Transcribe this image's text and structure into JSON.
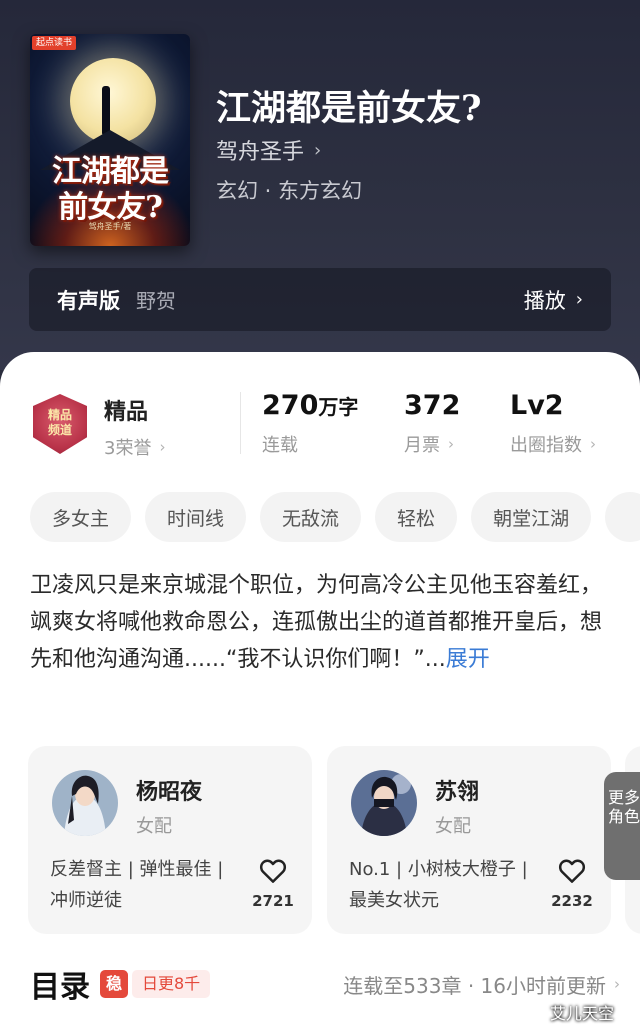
{
  "book": {
    "title": "江湖都是前女友?",
    "author": "驾舟圣手",
    "genre": "玄幻 · 东方玄幻",
    "cover": {
      "badge": "起点读书",
      "title_line1": "江湖都是",
      "title_line2": "前女友?",
      "author_small": "驾舟圣手/著"
    }
  },
  "audio": {
    "label": "有声版",
    "narrator": "野贺",
    "play_label": "播放"
  },
  "stats": {
    "medal_text_1": "精品",
    "medal_text_2": "频道",
    "quality": "精品",
    "honor": "3荣誉",
    "words_value": "270",
    "words_unit": "万字",
    "words_sub": "连载",
    "tickets_value": "372",
    "tickets_sub": "月票",
    "level_value": "Lv2",
    "level_sub": "出圈指数"
  },
  "tags": [
    "多女主",
    "时间线",
    "无敌流",
    "轻松",
    "朝堂江湖"
  ],
  "description": {
    "text": "卫凌风只是来京城混个职位，为何高冷公主见他玉容羞红，飒爽女将喊他救命恩公，连孤傲出尘的道首都推开皇后，想先和他沟通沟通......“我不认识你们啊！”...",
    "expand": "展开"
  },
  "characters": [
    {
      "name": "杨昭夜",
      "role": "女配",
      "desc": "反差督主 | 弹性最佳 | 冲师逆徒",
      "likes": "2721"
    },
    {
      "name": "苏翎",
      "role": "女配",
      "desc": "No.1 | 小树枝大橙子 | 最美女状元",
      "likes": "2232"
    }
  ],
  "more_characters": "更多角色",
  "toc": {
    "title": "目录",
    "stamp": "稳",
    "update_badge": "日更8千",
    "status": "连载至533章 · 16小时前更新"
  },
  "watermark": "艾儿天空",
  "colors": {
    "link": "#3a7bd5",
    "accent_red": "#e4493b",
    "hero_bg": "#2b2d3d"
  }
}
